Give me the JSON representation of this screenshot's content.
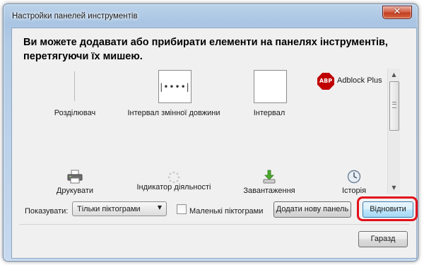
{
  "window": {
    "title": "Настройки панелей инструментів"
  },
  "heading": "Ви можете додавати або прибирати елементи на панелях інструментів, перетягуючи їх мишею.",
  "palette": {
    "items": [
      {
        "label": "Розділювач",
        "icon": "separator-icon"
      },
      {
        "label": "Інтервал змінної довжини",
        "icon": "flexible-space-icon"
      },
      {
        "label": "Інтервал",
        "icon": "space-icon"
      },
      {
        "label": "Adblock Plus",
        "icon": "adblock-plus-icon",
        "icon_text": "ABP"
      },
      {
        "label": "Друкувати",
        "icon": "printer-icon"
      },
      {
        "label": "Індикатор діяльності",
        "icon": "throbber-icon"
      },
      {
        "label": "Завантаження",
        "icon": "downloads-icon"
      },
      {
        "label": "Історія",
        "icon": "history-icon"
      }
    ],
    "flex_glyph": "|••••|"
  },
  "controls": {
    "show_label": "Показувати:",
    "show_select_value": "Тільки піктограми",
    "small_icons_label": "Маленькі піктограми",
    "small_icons_checked": false,
    "add_toolbar_button": "Додати нову панель",
    "restore_button": "Відновити",
    "ok_button": "Гаразд"
  },
  "colors": {
    "highlight": "#e3101a",
    "abp_red": "#c00000"
  }
}
